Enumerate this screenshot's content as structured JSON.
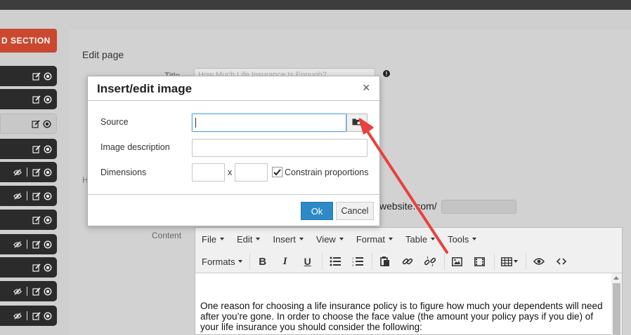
{
  "sidebar": {
    "add_section_label": "D SECTION",
    "items": [
      {
        "type": "dark",
        "icons": [
          "edit-icon",
          "circle-icon"
        ]
      },
      {
        "type": "dark",
        "icons": [
          "edit-icon",
          "circle-icon"
        ]
      },
      {
        "type": "light",
        "icons": [
          "edit-icon",
          "circle-icon"
        ]
      },
      {
        "type": "dark",
        "icons": [
          "edit-icon",
          "circle-icon"
        ]
      },
      {
        "type": "dark",
        "icons": [
          "eye-slash-icon",
          "edit-icon",
          "circle-icon"
        ]
      },
      {
        "type": "dark",
        "icons": [
          "eye-slash-icon",
          "edit-icon",
          "circle-icon"
        ]
      },
      {
        "type": "dark",
        "icons": [
          "edit-icon",
          "circle-icon"
        ]
      },
      {
        "type": "dark",
        "icons": [
          "eye-slash-icon",
          "edit-icon",
          "circle-icon"
        ]
      },
      {
        "type": "dark",
        "icons": [
          "edit-icon",
          "circle-icon"
        ]
      },
      {
        "type": "dark",
        "icons": [
          "eye-slash-icon",
          "edit-icon",
          "circle-icon"
        ]
      },
      {
        "type": "dark",
        "icons": [
          "eye-slash-icon",
          "edit-icon",
          "circle-icon"
        ]
      }
    ]
  },
  "page": {
    "heading": "Edit page",
    "title_label": "Title",
    "title_value": "How Much Life Insurance Is Enough?",
    "h_label": "H",
    "url_text": "website.com/",
    "content_label": "Content"
  },
  "editor": {
    "menus": [
      "File",
      "Edit",
      "Insert",
      "View",
      "Format",
      "Table",
      "Tools"
    ],
    "formats_label": "Formats",
    "body_text": "One reason for choosing a life insurance policy is to figure how much your dependents will need after you’re gone. In order to choose the face value (the amount your policy pays if you die) of your life insurance you should consider the following:"
  },
  "dialog": {
    "title": "Insert/edit image",
    "close_glyph": "×",
    "source_label": "Source",
    "source_value": "",
    "description_label": "Image description",
    "description_value": "",
    "dimensions_label": "Dimensions",
    "width_value": "",
    "height_value": "",
    "dimension_separator": "x",
    "constrain_label": "Constrain proportions",
    "constrain_checked": true,
    "ok_label": "Ok",
    "cancel_label": "Cancel"
  },
  "colors": {
    "accent_red": "#c9482f",
    "primary_blue": "#2d8ac7",
    "arrow_red": "#e8413f",
    "sidebar_dark": "#2b2b2b"
  }
}
